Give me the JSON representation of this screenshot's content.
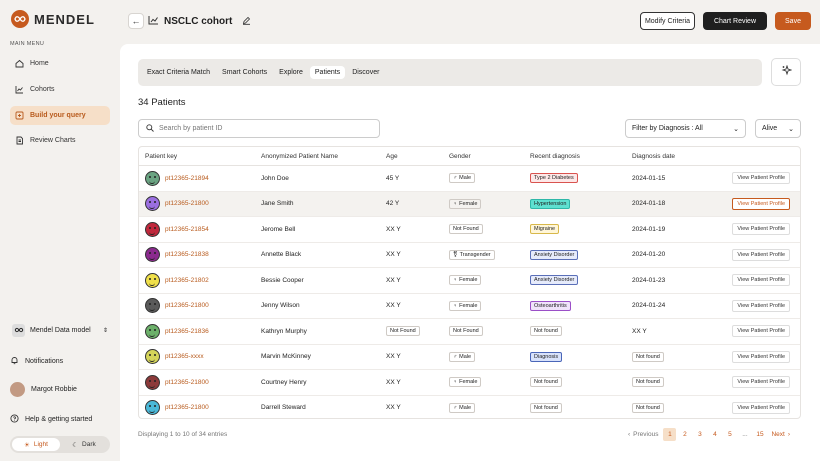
{
  "brand": {
    "name": "MENDEL",
    "accent": "#c65a1e"
  },
  "sidebar": {
    "heading": "MAIN MENU",
    "items": [
      {
        "label": "Home",
        "icon": "home-icon"
      },
      {
        "label": "Cohorts",
        "icon": "chart-icon"
      },
      {
        "label": "Build your query",
        "icon": "query-icon",
        "active": true
      },
      {
        "label": "Review Charts",
        "icon": "document-icon"
      }
    ],
    "data_model": "Mendel Data model",
    "notifications": "Notifications",
    "user": "Margot Robbie",
    "help": "Help & getting started",
    "theme": {
      "light": "Light",
      "dark": "Dark"
    }
  },
  "header": {
    "title": "NSCLC cohort",
    "modify": "Modify Criteria",
    "review": "Chart Review",
    "save": "Save"
  },
  "tabs": [
    "Exact Criteria Match",
    "Smart Cohorts",
    "Explore",
    "Patients",
    "Discover"
  ],
  "active_tab": "Patients",
  "patients_count": "34 Patients",
  "search": {
    "placeholder": "Search by patient ID"
  },
  "filter": {
    "label": "Filter by Diagnosis : All"
  },
  "status": {
    "label": "Alive"
  },
  "columns": [
    "Patient key",
    "Anonymized Patient Name",
    "Age",
    "Gender",
    "Recent diagnosis",
    "Diagnosis date",
    ""
  ],
  "rows": [
    {
      "key": "pt12365-21894",
      "name": "John Doe",
      "age": "45 Y",
      "gender": "Male",
      "gicon": "♂",
      "diag": "Type 2 Diabetes",
      "dcolor": "#d9534f",
      "dbg": "#fde8e8",
      "date": "2024-01-15",
      "action": "View Patient Profile",
      "face": "#6aa382"
    },
    {
      "key": "pt12365-21800",
      "name": "Jane Smith",
      "age": "42 Y",
      "gender": "Female",
      "gicon": "♀",
      "diag": "Hypertension",
      "dcolor": "#2fb7a8",
      "dbg": "#5ee0d0",
      "date": "2024-01-18",
      "action": "View Patient Profile",
      "face": "#9b6fe0",
      "hl": true
    },
    {
      "key": "pt12365-21854",
      "name": "Jerome Bell",
      "age": "XX Y",
      "gender": "Not Found",
      "gicon": "",
      "diag": "Migraine",
      "dcolor": "#d8b84a",
      "dbg": "#fff6d8",
      "date": "2024-01-19",
      "action": "View Patient Profile",
      "face": "#c0283c"
    },
    {
      "key": "pt12365-21838",
      "name": "Annette Black",
      "age": "XX Y",
      "gender": "Transgender",
      "gicon": "⚧",
      "diag": "Anxiety Disorder",
      "dcolor": "#5a6fb8",
      "dbg": "#e6ebfb",
      "date": "2024-01-20",
      "action": "View Patient Profile",
      "face": "#8b2a8e"
    },
    {
      "key": "pt12365-21802",
      "name": "Bessie Cooper",
      "age": "XX Y",
      "gender": "Female",
      "gicon": "♀",
      "diag": "Anxiety Disorder",
      "dcolor": "#5a6fb8",
      "dbg": "#e6ebfb",
      "date": "2024-01-23",
      "action": "View Patient Profile",
      "face": "#f0e04a"
    },
    {
      "key": "pt12365-21800",
      "name": "Jenny Wilson",
      "age": "XX Y",
      "gender": "Female",
      "gicon": "♀",
      "diag": "Osteoarthritis",
      "dcolor": "#9b4fc7",
      "dbg": "#f1e3fb",
      "date": "2024-01-24",
      "action": "View Patient Profile",
      "face": "#5a5a5a"
    },
    {
      "key": "pt12365-21836",
      "name": "Kathryn Murphy",
      "age": "Not Found",
      "gender": "Not Found",
      "gicon": "",
      "diag": "Not found",
      "dcolor": "#cfcac5",
      "dbg": "#ffffff",
      "date": "XX Y",
      "action": "View Patient Profile",
      "face": "#6cb06a",
      "agetag": true
    },
    {
      "key": "pt12365-xxxx",
      "name": "Marvin McKinney",
      "age": "XX Y",
      "gender": "Male",
      "gicon": "♂",
      "diag": "Diagnosis",
      "dcolor": "#4a66b8",
      "dbg": "#d8e2fb",
      "date": "Not found",
      "action": "View Patient Profile",
      "face": "#d4d45a",
      "datetag": true
    },
    {
      "key": "pt12365-21800",
      "name": "Courtney Henry",
      "age": "XX Y",
      "gender": "Female",
      "gicon": "♀",
      "diag": "Not found",
      "dcolor": "#cfcac5",
      "dbg": "#ffffff",
      "date": "Not found",
      "action": "View Patient Profile",
      "face": "#8c3a3a",
      "datetag": true
    },
    {
      "key": "pt12365-21800",
      "name": "Darrell Steward",
      "age": "XX Y",
      "gender": "Male",
      "gicon": "♂",
      "diag": "Not found",
      "dcolor": "#cfcac5",
      "dbg": "#ffffff",
      "date": "Not found",
      "action": "View Patient Profile",
      "face": "#4ab8d8",
      "datetag": true
    }
  ],
  "footer": {
    "info": "Displaying 1 to 10 of 34 entries"
  },
  "pager": {
    "prev": "Previous",
    "pages": [
      "1",
      "2",
      "3",
      "4",
      "5",
      "...",
      "15"
    ],
    "next": "Next",
    "current": "1"
  }
}
